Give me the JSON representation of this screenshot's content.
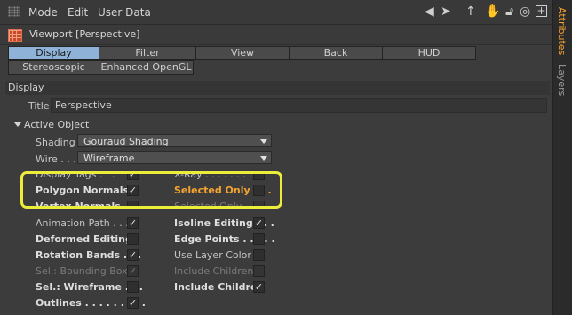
{
  "menu": {
    "items": [
      "Mode",
      "Edit",
      "User Data"
    ]
  },
  "toolbar": {
    "icons": [
      "back-arrow-icon",
      "cursor-icon",
      "up-arrow-icon",
      "hand-icon",
      "lock-icon",
      "target-icon",
      "add-icon"
    ]
  },
  "viewport": {
    "title": "Viewport [Perspective]"
  },
  "tabs": {
    "row1": [
      "Display",
      "Filter",
      "View",
      "Back",
      "HUD"
    ],
    "row2": [
      "Stereoscopic",
      "Enhanced OpenGL"
    ],
    "active": "Display"
  },
  "display_section": {
    "label": "Display",
    "title_label": "Title",
    "title_value": "Perspective"
  },
  "active_object": {
    "label": "Active Object",
    "shading_label": "Shading",
    "shading_value": "Gouraud Shading",
    "wire_label": "Wire . . .",
    "wire_value": "Wireframe"
  },
  "options_left": [
    {
      "label": "Display Tags . . .",
      "checked": true
    },
    {
      "label": "Polygon Normals",
      "checked": true
    },
    {
      "label": "Vertex Normals",
      "checked": false
    },
    {
      "label": "Animation Path . . .",
      "checked": true
    },
    {
      "label": "Deformed Editing",
      "checked": false
    },
    {
      "label": "Rotation Bands . . .",
      "checked": true
    },
    {
      "label": "Sel.: Bounding Box",
      "checked": true
    },
    {
      "label": "Sel.: Wireframe . . .",
      "checked": false
    },
    {
      "label": "Outlines . . . . . . . . .",
      "checked": true
    }
  ],
  "options_right": [
    {
      "label": "X-Ray . . . . . . . . . .",
      "checked": false
    },
    {
      "label": "Selected Only . . .",
      "checked": false
    },
    {
      "label": "Selected Only . . .",
      "checked": false
    },
    {
      "label": "Isoline Editing . . .",
      "checked": true
    },
    {
      "label": "Edge Points . . . . .",
      "checked": false
    },
    {
      "label": "Use Layer Color",
      "checked": false
    },
    {
      "label": "Include Children",
      "checked": false
    },
    {
      "label": "Include Children",
      "checked": true
    }
  ],
  "checkmark": "✓",
  "side_tabs": [
    "Attributes",
    "Layers"
  ],
  "colors": {
    "accent": "#8fb2d8",
    "highlight": "#ecec3a",
    "orange": "#f5a330"
  }
}
